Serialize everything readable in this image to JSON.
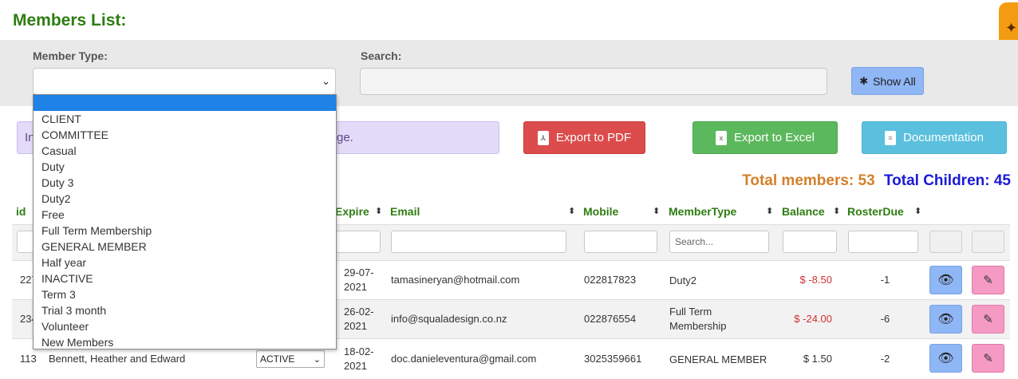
{
  "page": {
    "title": "Members List:"
  },
  "filters": {
    "member_type_label": "Member Type:",
    "member_type_value": "",
    "search_label": "Search:",
    "search_value": "",
    "show_all_label": "Show All",
    "show_all_icon": "asterisk-icon"
  },
  "dropdown": {
    "options": [
      "",
      "CLIENT",
      "COMMITTEE",
      "Casual",
      "Duty",
      "Duty 3",
      "Duty2",
      "Free",
      "Full Term Membership",
      "GENERAL MEMBER",
      "Half year",
      "INACTIVE",
      "Term 3",
      "Trial 3 month",
      "Volunteer",
      "New Members"
    ],
    "selected_index": 0,
    "highlight_color": "#1e82e6"
  },
  "info": {
    "text_start": "In",
    "text_end": "ge."
  },
  "actions": {
    "export_pdf": "Export to PDF",
    "export_excel": "Export to Excel",
    "documentation": "Documentation",
    "pdf_color": "#dc4c4c",
    "excel_color": "#5cb85c",
    "doc_color": "#5bc0de"
  },
  "totals": {
    "members_label": "Total members: 53",
    "children_label": "Total Children: 45"
  },
  "table": {
    "headers": {
      "id": "id",
      "expire": "Expire",
      "email": "Email",
      "mobile": "Mobile",
      "member_type": "MemberType",
      "balance": "Balance",
      "roster_due": "RosterDue"
    },
    "search_placeholder": "Search...",
    "rows": [
      {
        "id": "227",
        "name": "",
        "status": "",
        "expire": "29-07-2021",
        "email": "tamasineryan@hotmail.com",
        "mobile": "022817823",
        "type": "Duty2",
        "balance": "$ -8.50",
        "roster": "-1"
      },
      {
        "id": "234",
        "name": "",
        "status": "",
        "expire": "26-02-2021",
        "email": "info@squaladesign.co.nz",
        "mobile": "022876554",
        "type": "Full Term Membership",
        "balance": "$ -24.00",
        "roster": "-6"
      },
      {
        "id": "113",
        "name": "Bennett, Heather and Edward",
        "status": "ACTIVE",
        "expire": "18-02-2021",
        "email": "doc.danieleventura@gmail.com",
        "mobile": "3025359661",
        "type": "GENERAL MEMBER",
        "balance": "$ 1.50",
        "roster": "-2"
      }
    ]
  },
  "colors": {
    "header_green": "#2e7d12",
    "total_members": "#d4802b",
    "total_children": "#1a1ad6",
    "negative": "#d03030"
  }
}
